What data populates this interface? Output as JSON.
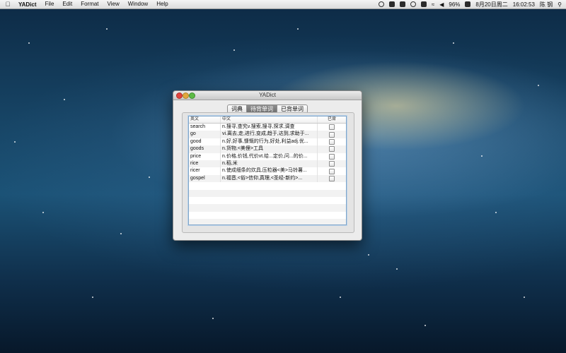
{
  "menubar": {
    "app_name": "YADict",
    "menus": [
      "File",
      "Edit",
      "Format",
      "View",
      "Window",
      "Help"
    ],
    "status": {
      "battery": "96%",
      "date": "8月20日周二",
      "time": "16:02:53",
      "user": "陈 钢"
    }
  },
  "window": {
    "title": "YADict",
    "tabs": [
      {
        "label": "词典",
        "selected": false
      },
      {
        "label": "待背单词",
        "selected": true
      },
      {
        "label": "已背单词",
        "selected": false
      }
    ],
    "table": {
      "headers": {
        "english": "英文",
        "chinese": "中文",
        "done": "已背"
      },
      "rows": [
        {
          "english": "search",
          "chinese": "n.搜寻,查究v.搜索,搜寻,探求,调查",
          "done": false
        },
        {
          "english": "go",
          "chinese": "vi.离去,走,进行,变成,趋于,达到,求助于...",
          "done": false
        },
        {
          "english": "good",
          "chinese": "n.好,好事,慷慨的行为,好处,利益adj.优...",
          "done": false
        },
        {
          "english": "goods",
          "chinese": "n.货物,<美俚>工具",
          "done": false
        },
        {
          "english": "price",
          "chinese": "n.价格,价钱,代价vt.给...定价,问...的价...",
          "done": false
        },
        {
          "english": "rice",
          "chinese": "n.稻,米",
          "done": false
        },
        {
          "english": "ricer",
          "chinese": "n.使成细条的炊具,压粒器<美>马铃薯...",
          "done": false
        },
        {
          "english": "gospel",
          "chinese": "n.福音,<俗>信仰,真理,<圣经-新约>...",
          "done": false
        }
      ]
    }
  },
  "colors": {
    "desktop_top": "#0d2a45",
    "desktop_mid": "#1b5276",
    "selection_tab": "#7a7a7a",
    "focus_ring": "#7fa5c9"
  }
}
